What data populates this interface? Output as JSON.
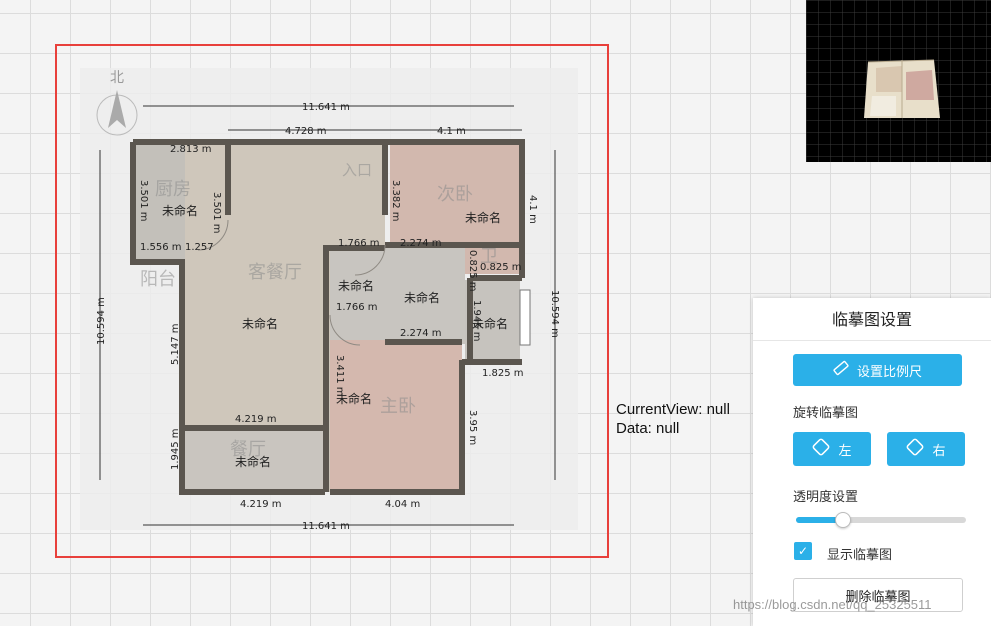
{
  "floorplan": {
    "compass_label": "北",
    "dims": {
      "top_total": "11.641 m",
      "top_left": "4.728 m",
      "top_right": "4.1 m",
      "bottom_total": "11.641 m",
      "bottom_left": "4.219 m",
      "bottom_right": "4.04 m",
      "left_total": "10.594 m",
      "right_total": "10.594 m",
      "kitchen_w": "2.813 m",
      "kitchen_h": "3.501 m",
      "kitchen_door": "3.501 m",
      "k_bottom_a": "1.556 m",
      "k_bottom_b": "1.257",
      "bed_h": "3.382 m",
      "right_upper": "4.1 m",
      "corr_a": "1.766 m",
      "corr_b": "2.274 m",
      "corr_c": "0.825 m",
      "bath_w": "1.766 m",
      "bath_b": "2.274 m",
      "living_h": "5.147 m",
      "study_h": "3.411 m",
      "bed2_h": "3.95 m",
      "dining_w": "4.219 m",
      "dining_h": "1.945 m",
      "corner_c": "1.825 m",
      "room_r_w": "0.825 m",
      "room_r_h": "1.945 m"
    },
    "room_label": "未命名",
    "bg_labels": {
      "kitchen": "厨房",
      "entrance": "入口",
      "second_bed": "次卧",
      "living": "客餐厅",
      "balcony": "阳台",
      "master": "主卧",
      "bath": "卫",
      "dining": "餐厅"
    }
  },
  "debug": {
    "current_view": "CurrentView: null",
    "data": "Data: null"
  },
  "panel": {
    "title": "临摹图设置",
    "scale_button": "设置比例尺",
    "rotate_label": "旋转临摹图",
    "rotate_left": "左",
    "rotate_right": "右",
    "opacity_label": "透明度设置",
    "opacity_value": 0.27,
    "show_label": "显示临摹图",
    "show_checked": true,
    "delete_button": "删除临摹图"
  },
  "watermark": "https://blog.csdn.net/qq_25325511",
  "colors": {
    "accent": "#2bb0e8",
    "frame": "#e8403b",
    "wall": "#5b564f"
  }
}
